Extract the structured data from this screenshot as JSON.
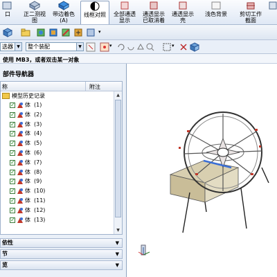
{
  "ribbon": {
    "items": [
      {
        "label": "口"
      },
      {
        "label": "正二测视",
        "label2": "图"
      },
      {
        "label": "带边着色",
        "label2": "(A)"
      },
      {
        "label": "线框对照"
      },
      {
        "label": "全部通透",
        "label2": "显示"
      },
      {
        "label": "通透显示",
        "label2": "已取消着"
      },
      {
        "label": "通透显示",
        "label2": "壳"
      },
      {
        "label": "浅色背景"
      },
      {
        "label": "剪切工作",
        "label2": "截面"
      }
    ]
  },
  "toolbar": {
    "filter_value": "选器",
    "assembly_value": "整个装配"
  },
  "cue": {
    "text": "使用 MB3，或者双击某一对象"
  },
  "navigator": {
    "title": "部件导航器",
    "col_name": "称",
    "col_note": "附注",
    "history_label": "模型历史记录",
    "rows": [
      {
        "type": "体",
        "num": "(1)"
      },
      {
        "type": "体",
        "num": "(2)"
      },
      {
        "type": "体",
        "num": "(3)"
      },
      {
        "type": "体",
        "num": "(4)"
      },
      {
        "type": "体",
        "num": "(5)"
      },
      {
        "type": "体",
        "num": "(6)"
      },
      {
        "type": "体",
        "num": "(7)"
      },
      {
        "type": "体",
        "num": "(8)"
      },
      {
        "type": "体",
        "num": "(9)"
      },
      {
        "type": "体",
        "num": "(10)"
      },
      {
        "type": "体",
        "num": "(11)"
      },
      {
        "type": "体",
        "num": "(12)"
      },
      {
        "type": "体",
        "num": "(13)"
      }
    ],
    "sections": [
      {
        "label": "依性"
      },
      {
        "label": "节"
      },
      {
        "label": "览"
      }
    ]
  },
  "colors": {
    "accent": "#2b5797",
    "panel": "#eaf0f8"
  }
}
